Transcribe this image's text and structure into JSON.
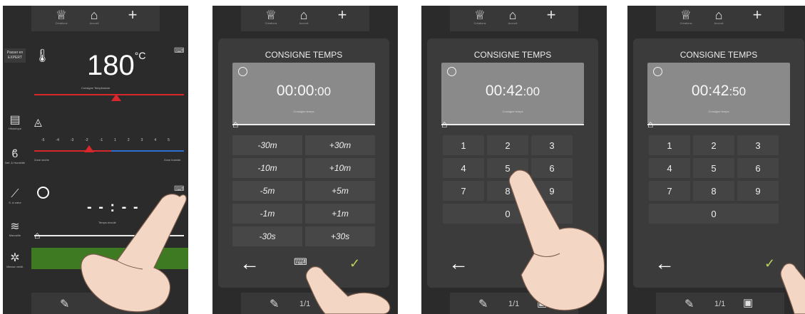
{
  "topbar": {
    "chef_icon": "chef-hat-icon",
    "chef_label": "Créations",
    "home_icon": "home-icon",
    "home_label": "Accueil",
    "plus_label": "+"
  },
  "panel1": {
    "expert_label": "Passer en EXPERT",
    "temperature_value": "180",
    "temperature_unit": "°C",
    "temperature_caption": "Consigne Température",
    "humidity_scale": [
      "-5",
      "-4",
      "-3",
      "-2",
      "-1",
      "1",
      "2",
      "3",
      "4",
      "5"
    ],
    "dry_label": "Zone sèche",
    "humid_label": "Zone humide",
    "time_display": "- - : - -",
    "time_caption": "Temps écoulé",
    "side_items": [
      {
        "icon": "recipe-book-icon",
        "label": "Historique"
      },
      {
        "icon": "moisture-icon",
        "label": "Nef. & Humidité"
      },
      {
        "icon": "probe-icon",
        "label": "S. à cœur"
      },
      {
        "icon": "layers-icon",
        "label": "Manuelle"
      },
      {
        "icon": "fan-icon",
        "label": "Vitesse ventil."
      }
    ]
  },
  "dialog": {
    "title": "CONSIGNE TEMPS",
    "time_caption": "Consigne temps"
  },
  "panel2": {
    "time_main": "00:00",
    "time_sec": ":00",
    "buttons": [
      "-30m",
      "+30m",
      "-10m",
      "+10m",
      "-5m",
      "+5m",
      "-1m",
      "+1m",
      "-30s",
      "+30s"
    ],
    "page_indicator": "1/1"
  },
  "panel3": {
    "time_main": "00:42",
    "time_sec": ":00",
    "keys": [
      "1",
      "2",
      "3",
      "4",
      "5",
      "6",
      "7",
      "8",
      "9"
    ],
    "zero": "0",
    "page_indicator": "1/1"
  },
  "panel4": {
    "time_main": "00:42",
    "time_sec": ":50",
    "keys": [
      "1",
      "2",
      "3",
      "4",
      "5",
      "6",
      "7",
      "8",
      "9"
    ],
    "zero": "0",
    "page_indicator": "1/1"
  },
  "colors": {
    "panel_bg": "#2b2b2b",
    "dialog_bg": "#3b3b3b",
    "display_bg": "#8a8a8a",
    "accent_red": "#d9262b",
    "accent_blue": "#2f6fd0",
    "check_green": "#b9d65a"
  }
}
